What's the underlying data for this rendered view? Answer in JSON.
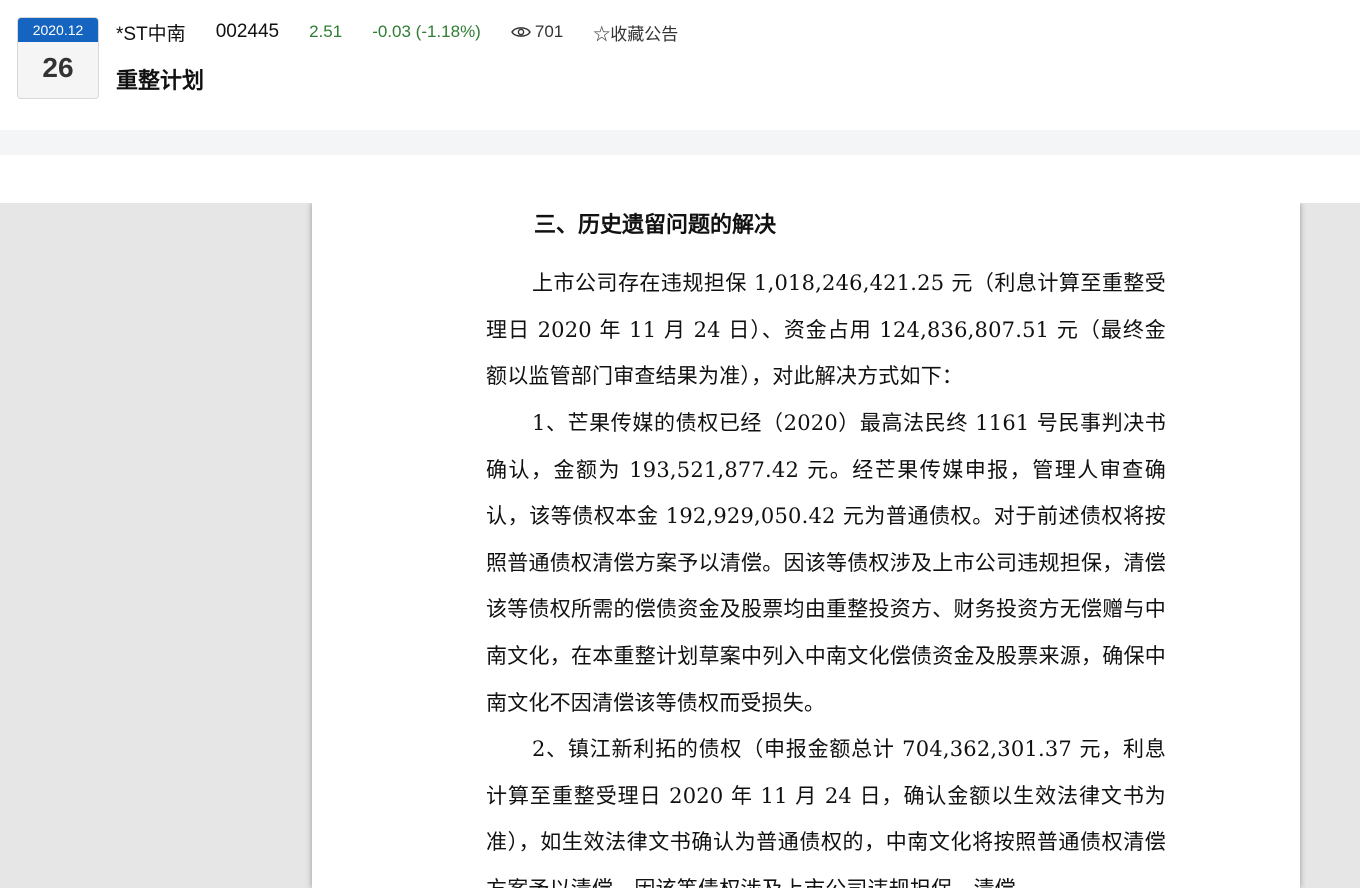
{
  "header": {
    "date_month": "2020.12",
    "date_day": "26",
    "stock_name": "*ST中南",
    "stock_code": "002445",
    "price": "2.51",
    "change": "-0.03 (-1.18%)",
    "views": "701",
    "favorite_label": "☆收藏公告",
    "title": "重整计划",
    "colors": {
      "accent": "#1565c0",
      "change_color": "#2e7d32"
    }
  },
  "document": {
    "heading": "三、历史遗留问题的解决",
    "paragraphs": [
      "上市公司存在违规担保 1,018,246,421.25 元（利息计算至重整受理日 2020 年 11 月 24 日）、资金占用 124,836,807.51 元（最终金额以监管部门审查结果为准），对此解决方式如下：",
      "1、芒果传媒的债权已经（2020）最高法民终 1161 号民事判决书确认，金额为 193,521,877.42 元。经芒果传媒申报，管理人审查确认，该等债权本金 192,929,050.42 元为普通债权。对于前述债权将按照普通债权清偿方案予以清偿。因该等债权涉及上市公司违规担保，清偿该等债权所需的偿债资金及股票均由重整投资方、财务投资方无偿赠与中南文化，在本重整计划草案中列入中南文化偿债资金及股票来源，确保中南文化不因清偿该等债权而受损失。",
      "2、镇江新利拓的债权（申报金额总计 704,362,301.37 元，利息计算至重整受理日 2020 年 11 月 24 日，确认金额以生效法律文书为准），如生效法律文书确认为普通债权的，中南文化将按照普通债权清偿方案予以清偿。因该等债权涉及上市公司违规担保，清偿"
    ]
  }
}
